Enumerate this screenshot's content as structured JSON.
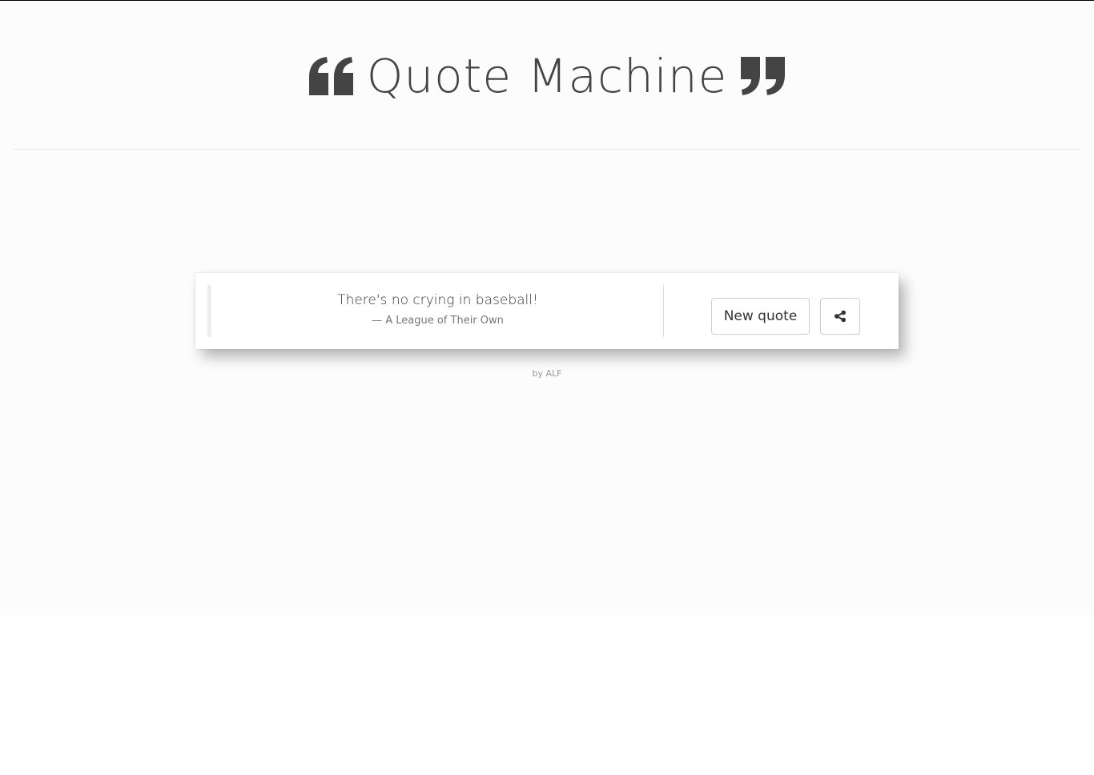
{
  "header": {
    "title": "Quote Machine",
    "left_icon": "quote-left-icon",
    "right_icon": "quote-right-icon"
  },
  "quote": {
    "text": "There's no crying in baseball!",
    "source": "— A League of Their Own"
  },
  "actions": {
    "new_quote_label": "New quote",
    "share_icon": "share-icon"
  },
  "footer": {
    "credit": "by ALF"
  },
  "colors": {
    "background": "#fcfcfc",
    "title": "#444444",
    "card": "#ffffff",
    "text": "#333333",
    "muted": "#777777"
  }
}
